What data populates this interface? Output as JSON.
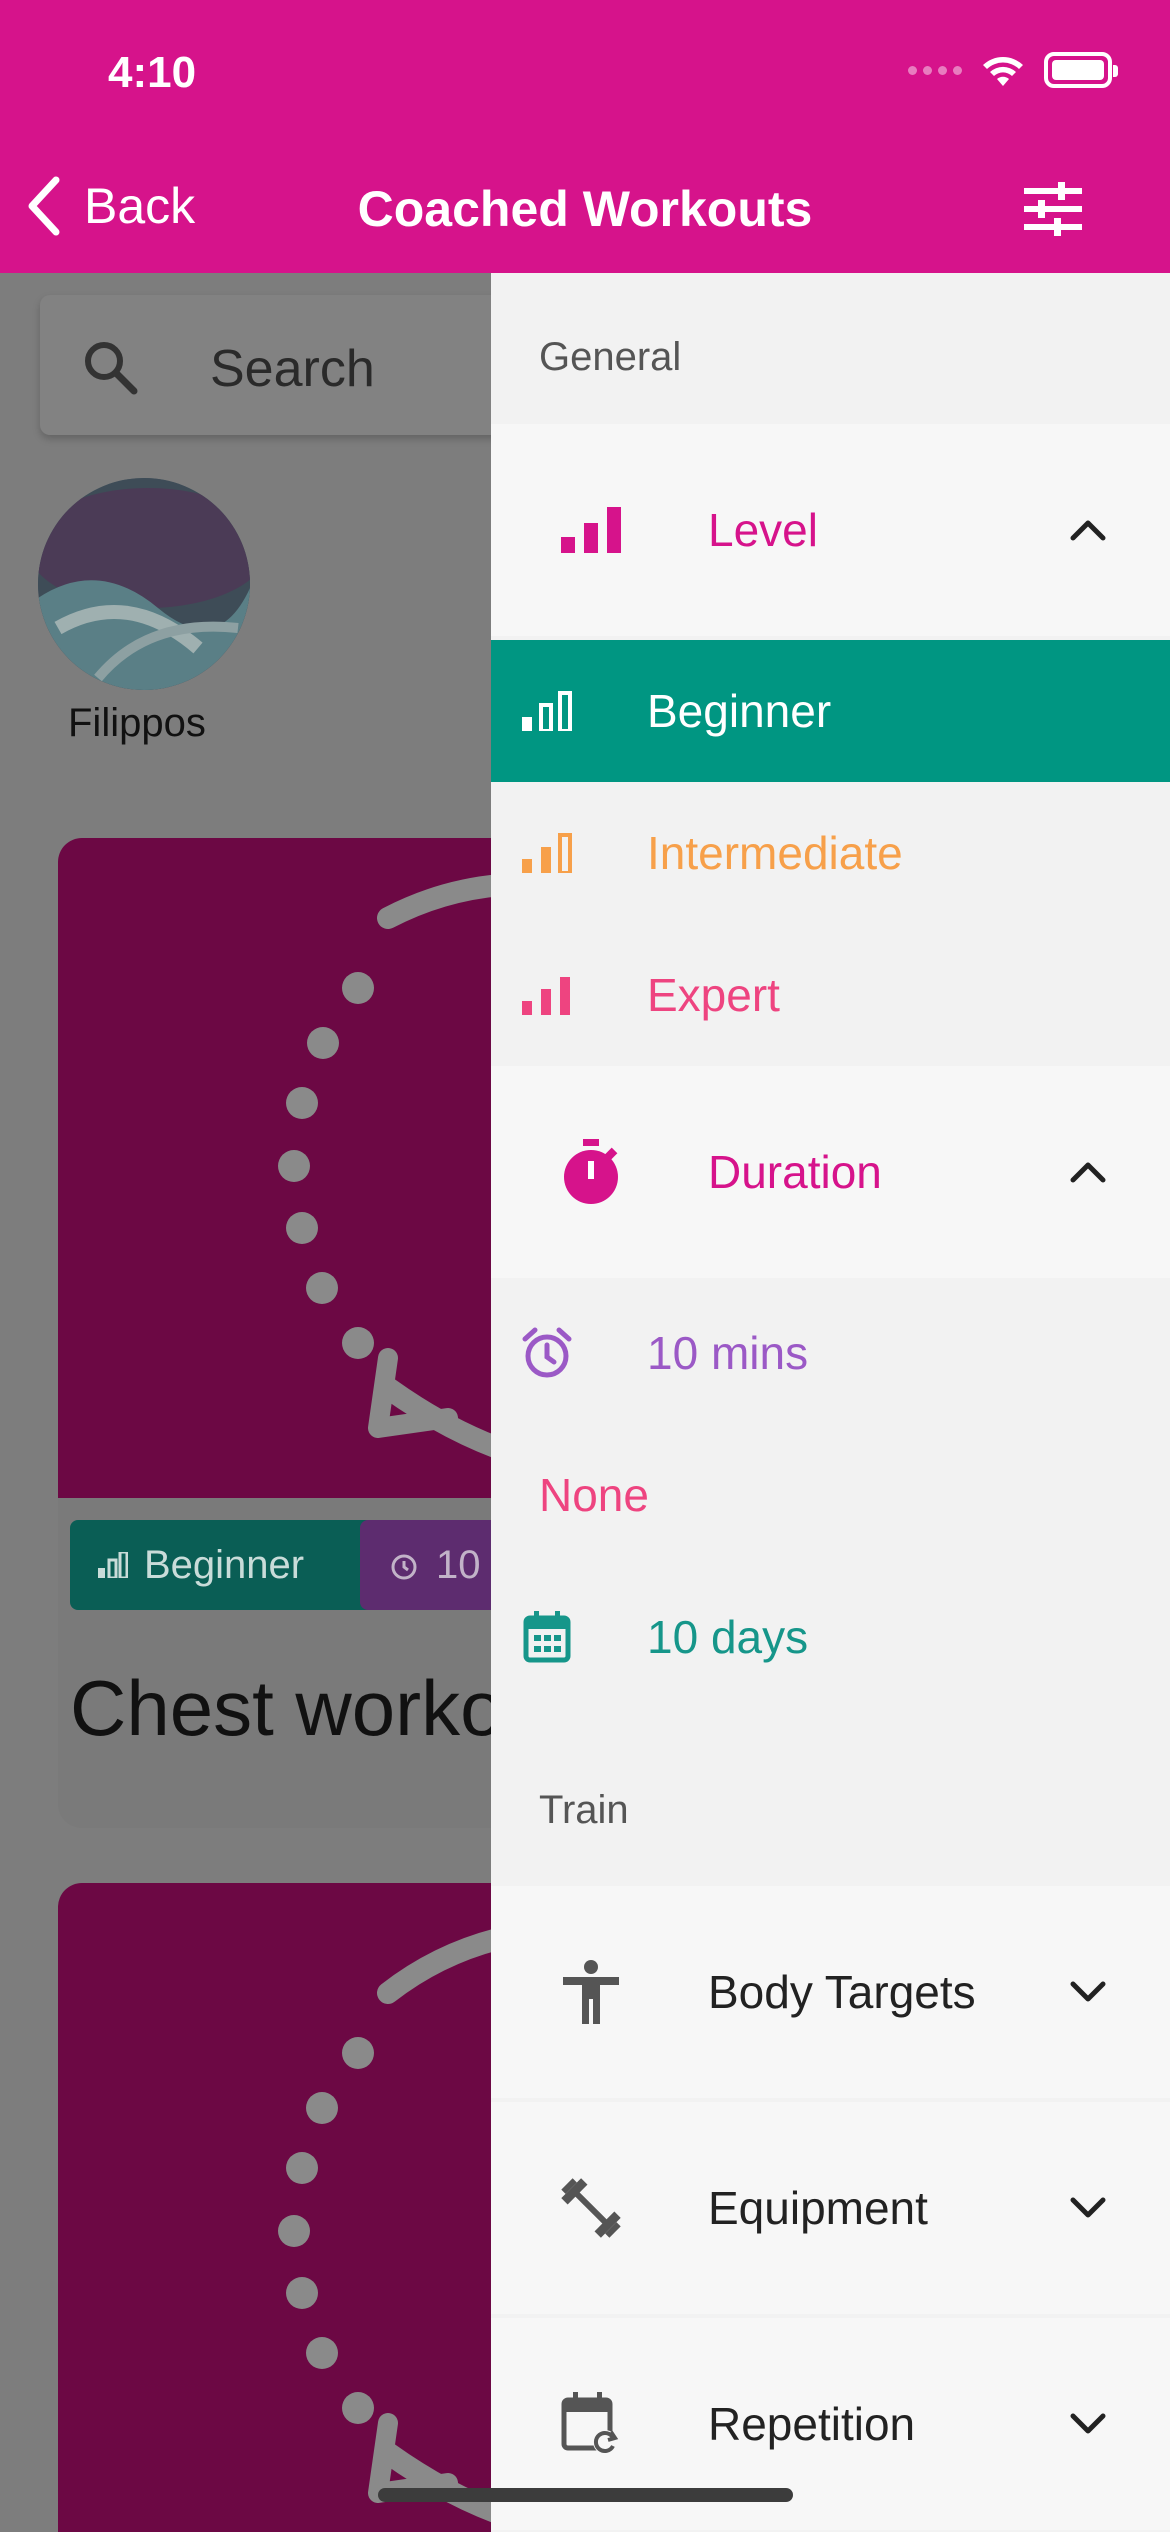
{
  "status": {
    "time": "4:10"
  },
  "nav": {
    "back_label": "Back",
    "title": "Coached Workouts",
    "filter_icon": "sliders-icon"
  },
  "background": {
    "search_placeholder": "Search",
    "coach_name": "Filippos",
    "card": {
      "level_tag": "Beginner",
      "duration_tag": "10",
      "title": "Chest workout"
    }
  },
  "drawer": {
    "general_title": "General",
    "level": {
      "label": "Level",
      "options": [
        {
          "label": "Beginner",
          "color": "#ffffff",
          "selected": true
        },
        {
          "label": "Intermediate",
          "color": "#f7a04a",
          "selected": false
        },
        {
          "label": "Expert",
          "color": "#ee4480",
          "selected": false
        }
      ]
    },
    "duration": {
      "label": "Duration",
      "options": [
        {
          "label": "10 mins",
          "color": "#9b59c6"
        },
        {
          "label": "None",
          "color": "#ee4480"
        },
        {
          "label": "10 days",
          "color": "#16968a"
        }
      ]
    },
    "train_title": "Train",
    "train_items": [
      {
        "label": "Body Targets",
        "icon": "person-icon"
      },
      {
        "label": "Equipment",
        "icon": "dumbbell-icon"
      },
      {
        "label": "Repetition",
        "icon": "calendar-repeat-icon"
      }
    ]
  },
  "colors": {
    "primary": "#d6138b",
    "teal": "#009682"
  }
}
